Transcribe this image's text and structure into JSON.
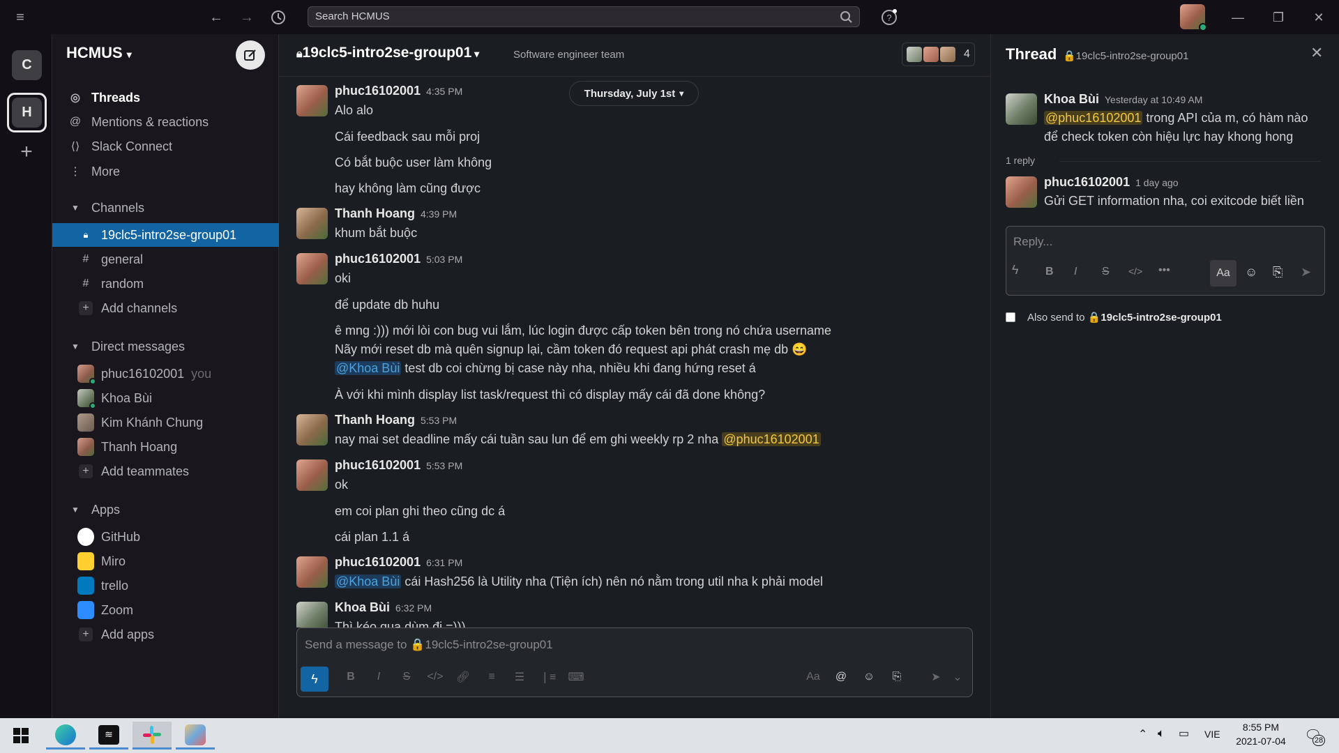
{
  "topbar": {
    "search_placeholder": "Search HCMUS"
  },
  "rail": {
    "workspaces": [
      "C",
      "H"
    ],
    "add": "+"
  },
  "sidebar": {
    "workspace_name": "HCMUS",
    "nav": [
      {
        "label": "Threads",
        "icon": "threads-icon"
      },
      {
        "label": "Mentions & reactions",
        "icon": "at-icon"
      },
      {
        "label": "Slack Connect",
        "icon": "connect-icon"
      },
      {
        "label": "More",
        "icon": "more-icon"
      }
    ],
    "channels_header": "Channels",
    "channels": [
      {
        "label": "19clc5-intro2se-group01",
        "prefix": "🔒",
        "active": true
      },
      {
        "label": "general",
        "prefix": "#"
      },
      {
        "label": "random",
        "prefix": "#"
      },
      {
        "label": "Add channels",
        "prefix": "+"
      }
    ],
    "dm_header": "Direct messages",
    "dms": [
      {
        "label": "phuc16102001",
        "suffix": "you"
      },
      {
        "label": "Khoa Bùi"
      },
      {
        "label": "Kim Khánh Chung"
      },
      {
        "label": "Thanh Hoang"
      },
      {
        "label": "Add teammates"
      }
    ],
    "apps_header": "Apps",
    "apps": [
      {
        "label": "GitHub",
        "color": "#ffffff"
      },
      {
        "label": "Miro",
        "color": "#ffd02f"
      },
      {
        "label": "trello",
        "color": "#0079bf"
      },
      {
        "label": "Zoom",
        "color": "#2d8cff"
      },
      {
        "label": "Add apps"
      }
    ]
  },
  "channel": {
    "name": "19clc5-intro2se-group01",
    "topic": "Software engineer team",
    "member_count": "4",
    "date_divider": "Thursday, July 1st"
  },
  "messages": [
    {
      "author": "phuc16102001",
      "time": "4:35 PM",
      "lines": [
        "Alo alo",
        "Cái feedback sau mỗi proj",
        "Có bắt buộc user làm không",
        "hay không làm cũng được"
      ]
    },
    {
      "author": "Thanh Hoang",
      "time": "4:39 PM",
      "lines": [
        "khum bắt buộc"
      ]
    },
    {
      "author": "phuc16102001",
      "time": "5:03 PM",
      "lines": [
        "oki",
        "để update db huhu",
        "ê mng :))) mới lòi con bug vui lắm, lúc login được cấp token bên trong nó chứa username",
        "Nãy mới reset db mà quên signup lại, cầm token đó request api phát crash mẹ db 😄",
        "@Khoa Bùi",
        " test db coi chừng bị case này nha, nhiều khi đang hứng reset á",
        "À với khi mình display list task/request thì có display mấy cái đã done không?"
      ]
    },
    {
      "author": "Thanh Hoang",
      "time": "5:53 PM",
      "lines": [
        "nay mai set deadline mấy cái tuần sau lun để em ghi weekly rp 2 nha ",
        "@phuc16102001"
      ]
    },
    {
      "author": "phuc16102001",
      "time": "5:53 PM",
      "lines": [
        "ok",
        "em coi plan ghi theo cũng dc á",
        "cái plan 1.1 á"
      ]
    },
    {
      "author": "phuc16102001",
      "time": "6:31 PM",
      "lines": [
        "@Khoa Bùi",
        " cái Hash256 là Utility nha (Tiện ích) nên nó nằm trong util nha k phải model"
      ]
    },
    {
      "author": "Khoa Bùi",
      "time": "6:32 PM",
      "lines": [
        "Thì kéo qua dùm đi =)))"
      ]
    }
  ],
  "composer": {
    "placeholder": "Send a message to 🔒19clc5-intro2se-group01"
  },
  "thread": {
    "title": "Thread",
    "channel": "🔒19clc5-intro2se-group01",
    "parent": {
      "author": "Khoa Bùi",
      "time": "Yesterday at 10:49 AM",
      "mention": "@phuc16102001",
      "text": " trong API của m, có hàm nào",
      "text2": "để check token còn hiệu lực hay khong hong"
    },
    "reply_count": "1 reply",
    "reply": {
      "author": "phuc16102001",
      "time": "1 day ago",
      "text": "Gửi GET information nha, coi exitcode biết liền"
    },
    "reply_placeholder": "Reply...",
    "also_send_label": "Also send to",
    "also_send_channel": "🔒19clc5-intro2se-group01"
  },
  "taskbar": {
    "lang": "VIE",
    "time": "8:55 PM",
    "date": "2021-07-04",
    "notifications": "28"
  }
}
